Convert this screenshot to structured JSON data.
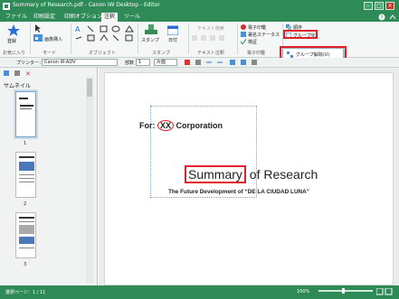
{
  "window": {
    "title": "Summary of Research.pdf - Canon iW Desktop - Editor"
  },
  "menubar": {
    "items": [
      "ファイル",
      "印刷設定",
      "印刷オプション",
      "注釈",
      "ツール"
    ],
    "active_index": 3
  },
  "ribbon": {
    "favorites_label": "お気に入り",
    "mode_label": "モード",
    "object_label": "オブジェクト",
    "stamp_group_label": "スタンプ",
    "text_annot_label": "テキスト注釈",
    "esign_label": "電子印鑑",
    "select_label": "選択",
    "zoom_label": "画像挿入",
    "stamp_btn": "スタンプ",
    "date_btn": "日付",
    "text_search_placeholder": "テキスト検索",
    "e_seal_btn": "電子印鑑",
    "sign_status_btn": "署名ステータス",
    "verify_btn": "検証",
    "order_btn": "順序",
    "group_btn": "グループ化"
  },
  "popup": {
    "item": "グループ解除(U)"
  },
  "toolbar2": {
    "printer_label": "プリンター：",
    "printer_value": "Canon iR-ADV",
    "copies_label": "部数",
    "copies_value": "1",
    "duplex_value": "片面"
  },
  "leftpane": {
    "title": "サムネイル",
    "pages": [
      "1",
      "2",
      "3"
    ]
  },
  "document": {
    "line1_prefix": "For:",
    "line1_mark": "XX",
    "line1_suffix": "Corporation",
    "title_main": "Summary",
    "title_rest": "of Research",
    "subtitle": "The Future Development of “DE LA CIUDAD LUNA”"
  },
  "status": {
    "page_info": "選択ページ：1 / 11",
    "zoom": "100%"
  }
}
